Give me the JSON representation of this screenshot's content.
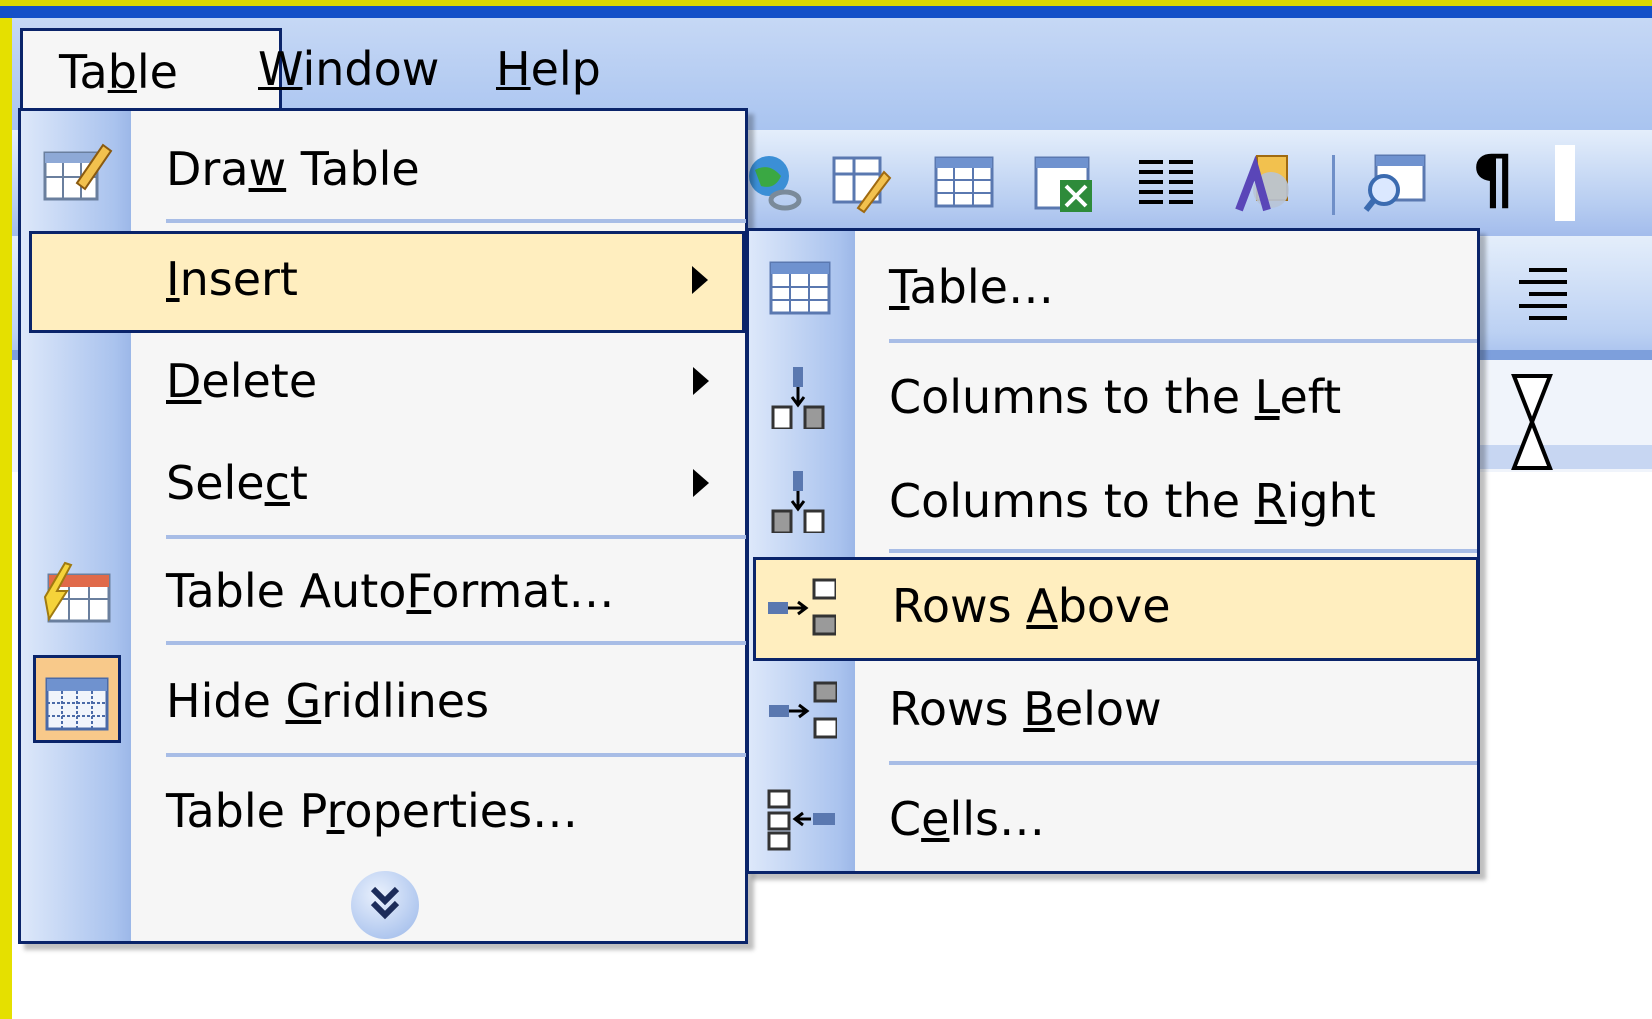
{
  "menubar": {
    "items": [
      {
        "pre": "Ta",
        "u": "b",
        "post": "le"
      },
      {
        "pre": "",
        "u": "W",
        "post": "indow"
      },
      {
        "pre": "",
        "u": "H",
        "post": "elp"
      }
    ]
  },
  "toolbar": {
    "icons": [
      "globe-link-icon",
      "draw-table-icon",
      "insert-table-icon",
      "insert-excel-icon",
      "columns-icon",
      "drawing-icon",
      "document-map-icon",
      "pilcrow-icon"
    ],
    "pilcrow": "¶"
  },
  "table_menu": {
    "items": [
      {
        "pre": "Dra",
        "u": "w",
        "post": " Table",
        "icon": "draw-table-icon",
        "submenu": false
      },
      {
        "pre": "",
        "u": "I",
        "post": "nsert",
        "icon": "",
        "submenu": true
      },
      {
        "pre": "",
        "u": "D",
        "post": "elete",
        "icon": "",
        "submenu": true
      },
      {
        "pre": "Sele",
        "u": "c",
        "post": "t",
        "icon": "",
        "submenu": true
      },
      {
        "pre": "Table Auto",
        "u": "F",
        "post": "ormat…",
        "icon": "autoformat-icon",
        "submenu": false
      },
      {
        "pre": "Hide ",
        "u": "G",
        "post": "ridlines",
        "icon": "gridlines-icon",
        "submenu": false
      },
      {
        "pre": "Table P",
        "u": "r",
        "post": "operties…",
        "icon": "",
        "submenu": false
      }
    ],
    "more_icon": "expand-chevron-icon"
  },
  "insert_submenu": {
    "items": [
      {
        "pre": "",
        "u": "T",
        "post": "able…",
        "icon": "table-icon"
      },
      {
        "pre": "Columns to the ",
        "u": "L",
        "post": "eft",
        "icon": "insert-columns-left-icon"
      },
      {
        "pre": "Columns to the ",
        "u": "R",
        "post": "ight",
        "icon": "insert-columns-right-icon"
      },
      {
        "pre": "Rows ",
        "u": "A",
        "post": "bove",
        "icon": "insert-rows-above-icon"
      },
      {
        "pre": "Rows ",
        "u": "B",
        "post": "elow",
        "icon": "insert-rows-below-icon"
      },
      {
        "pre": "C",
        "u": "e",
        "post": "lls…",
        "icon": "insert-cells-icon"
      }
    ]
  },
  "colors": {
    "highlight": "#ffeebf",
    "menu_border": "#0a246a",
    "gutter": "#aac3ee"
  }
}
